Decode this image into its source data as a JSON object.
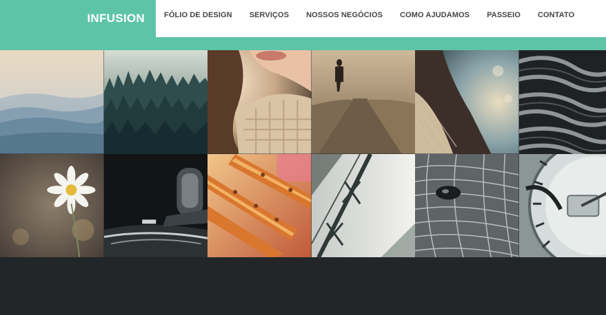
{
  "brand": {
    "name": "INFUSION",
    "accent": "#5ec4a8"
  },
  "nav": {
    "items": [
      {
        "label": "FÓLIO DE DESIGN"
      },
      {
        "label": "SERVIÇOS"
      },
      {
        "label": "NOSSOS NEGÓCIOS"
      },
      {
        "label": "COMO AJUDAMOS"
      },
      {
        "label": "PASSEIO"
      },
      {
        "label": "CONTATO"
      }
    ]
  },
  "gallery": {
    "tiles": [
      {
        "subject": "misty-mountains"
      },
      {
        "subject": "pine-forest"
      },
      {
        "subject": "woman-portrait"
      },
      {
        "subject": "person-walking-road"
      },
      {
        "subject": "woman-hair-light"
      },
      {
        "subject": "rope-texture"
      },
      {
        "subject": "daisy-flower"
      },
      {
        "subject": "car-gear-shift"
      },
      {
        "subject": "food-pastry"
      },
      {
        "subject": "barbed-wire"
      },
      {
        "subject": "bird-eye-closeup"
      },
      {
        "subject": "speedometer-gauge"
      }
    ]
  },
  "colors": {
    "footer": "#222629",
    "nav_text": "#454545"
  }
}
